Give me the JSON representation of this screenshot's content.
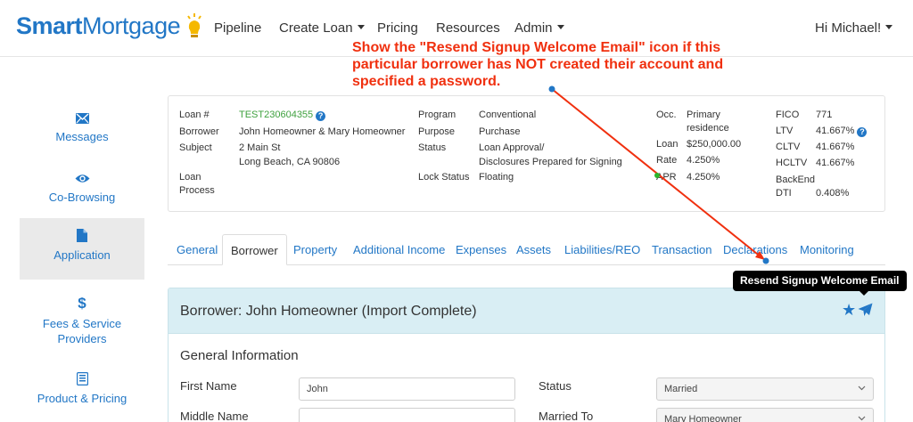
{
  "brand": {
    "part1": "Smart",
    "part2": "Mortgage"
  },
  "nav": {
    "pipeline": "Pipeline",
    "create_loan": "Create Loan",
    "pricing": "Pricing",
    "resources": "Resources",
    "admin": "Admin",
    "user": "Hi Michael!"
  },
  "annotation": {
    "line1": "Show the \"Resend Signup Welcome Email\" icon if this",
    "line2": "particular borrower has NOT created their account and",
    "line3": "specified a password."
  },
  "sidebar": {
    "items": [
      {
        "label": "Messages",
        "icon": "envelope-icon"
      },
      {
        "label": "Co-Browsing",
        "icon": "eye-icon"
      },
      {
        "label": "Application",
        "icon": "file-icon"
      },
      {
        "label": "Fees & Service Providers",
        "icon": "dollar-icon"
      },
      {
        "label": "Product & Pricing",
        "icon": "list-icon"
      }
    ]
  },
  "summary": {
    "loan_label": "Loan #",
    "loan_value": "TEST230604355",
    "borrower_label": "Borrower",
    "borrower_value": "John Homeowner & Mary Homeowner",
    "subject_label": "Subject",
    "subject_line1": "2 Main St",
    "subject_line2": "Long Beach, CA 90806",
    "process_label1": "Loan",
    "process_label2": "Process",
    "program_label": "Program",
    "program_value": "Conventional",
    "purpose_label": "Purpose",
    "purpose_value": "Purchase",
    "status_label": "Status",
    "status_line1": "Loan Approval/",
    "status_line2": "Disclosures Prepared for Signing",
    "lock_label": "Lock Status",
    "lock_value": "Floating",
    "occ_label": "Occ.",
    "occ_line1": "Primary",
    "occ_line2": "residence",
    "loan_amt_label": "Loan",
    "loan_amt_value": "$250,000.00",
    "rate_label": "Rate",
    "rate_value": "4.250%",
    "apr_label": "APR",
    "apr_value": "4.250%",
    "fico_label": "FICO",
    "fico_value": "771",
    "ltv_label": "LTV",
    "ltv_value": "41.667%",
    "cltv_label": "CLTV",
    "cltv_value": "41.667%",
    "hcltv_label": "HCLTV",
    "hcltv_value": "41.667%",
    "dti_label1": "BackEnd",
    "dti_label2": "DTI",
    "dti_value": "0.408%"
  },
  "tabs": [
    {
      "label": "General"
    },
    {
      "label": "Borrower"
    },
    {
      "label": "Property"
    },
    {
      "label": "Additional Income"
    },
    {
      "label": "Expenses"
    },
    {
      "label": "Assets"
    },
    {
      "label": "Liabilities/REO"
    },
    {
      "label": "Transaction"
    },
    {
      "label": "Declarations"
    },
    {
      "label": "Monitoring"
    }
  ],
  "tooltip": "Resend Signup Welcome Email",
  "panel": {
    "title": "Borrower: John Homeowner (Import Complete)",
    "section": "General Information",
    "first_name_label": "First Name",
    "first_name_value": "John",
    "middle_name_label": "Middle Name",
    "middle_name_value": "",
    "status_label": "Status",
    "status_value": "Married",
    "married_to_label": "Married To",
    "married_to_value": "Mary Homeowner"
  },
  "colors": {
    "brand_blue": "#2277c6",
    "annotation_red": "#f0300f",
    "panel_header": "#d9eef4",
    "loan_green": "#3fa13f"
  }
}
